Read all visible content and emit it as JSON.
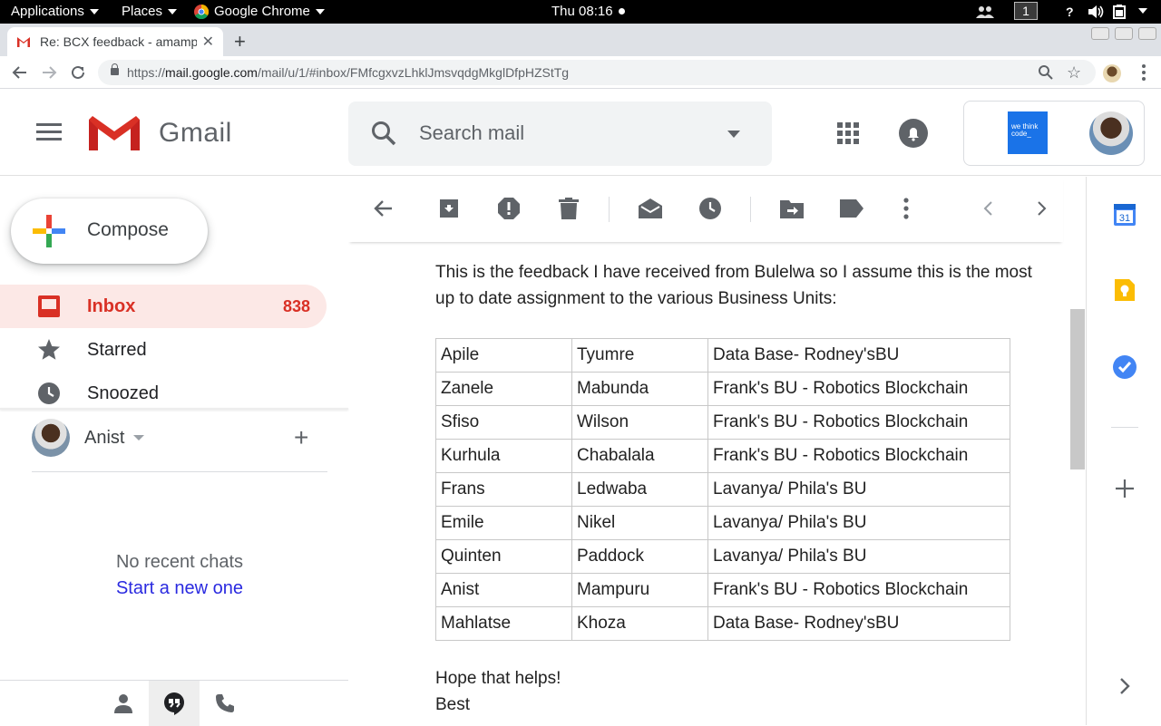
{
  "os_topbar": {
    "applications": "Applications",
    "places": "Places",
    "browser_app": "Google Chrome",
    "clock": "Thu 08:16",
    "workspace": "1"
  },
  "browser": {
    "tab_title": "Re: BCX feedback - amampuru@",
    "url_prefix": "https://",
    "url_host": "mail.google.com",
    "url_path": "/mail/u/1/#inbox/FMfcgxvzLhklJmsvqdgMkglDfpHZStTg"
  },
  "gmail": {
    "brand": "Gmail",
    "search_placeholder": "Search mail",
    "org_logo_text": "we think code_"
  },
  "sidebar": {
    "compose_label": "Compose",
    "items": [
      {
        "label": "Inbox",
        "count": "838",
        "icon": "inbox-icon",
        "active": true
      },
      {
        "label": "Starred",
        "count": "",
        "icon": "star-icon"
      },
      {
        "label": "Snoozed",
        "count": "",
        "icon": "clock-icon"
      }
    ],
    "hangouts": {
      "user": "Anist",
      "no_chats": "No recent chats",
      "start_new": "Start a new one"
    }
  },
  "toolbar": {
    "icons": [
      "back-arrow-icon",
      "archive-icon",
      "report-spam-icon",
      "delete-icon",
      "mark-unread-icon",
      "snooze-icon",
      "move-to-icon",
      "labels-icon",
      "more-icon",
      "newer-icon",
      "older-icon"
    ]
  },
  "message": {
    "intro": "This is the feedback I have received from Bulelwa so I assume this is the most up to date assignment to the various Business Units:",
    "table": [
      [
        "Apile",
        "Tyumre",
        "Data Base- Rodney'sBU"
      ],
      [
        "Zanele",
        "Mabunda",
        "Frank's BU - Robotics Blockchain"
      ],
      [
        "Sfiso",
        "Wilson",
        "Frank's BU - Robotics Blockchain"
      ],
      [
        "Kurhula",
        "Chabalala",
        "Frank's BU - Robotics Blockchain"
      ],
      [
        "Frans",
        "Ledwaba",
        "Lavanya/ Phila's BU"
      ],
      [
        "Emile",
        "Nikel",
        "Lavanya/ Phila's BU"
      ],
      [
        "Quinten",
        "Paddock",
        "Lavanya/ Phila's BU"
      ],
      [
        "Anist",
        "Mampuru",
        "Frank's BU - Robotics Blockchain"
      ],
      [
        "Mahlatse",
        "Khoza",
        "Data Base- Rodney'sBU"
      ]
    ],
    "closing_1": "Hope that helps!",
    "closing_2": "Best"
  },
  "side_panel": {
    "calendar_day": "31",
    "icons": [
      "calendar-icon",
      "keep-icon",
      "tasks-icon",
      "add-addon-icon",
      "expand-panel-icon"
    ]
  },
  "colors": {
    "gmail_red": "#d93025",
    "inbox_bg": "#fce8e6",
    "link": "#2a2ae0"
  }
}
